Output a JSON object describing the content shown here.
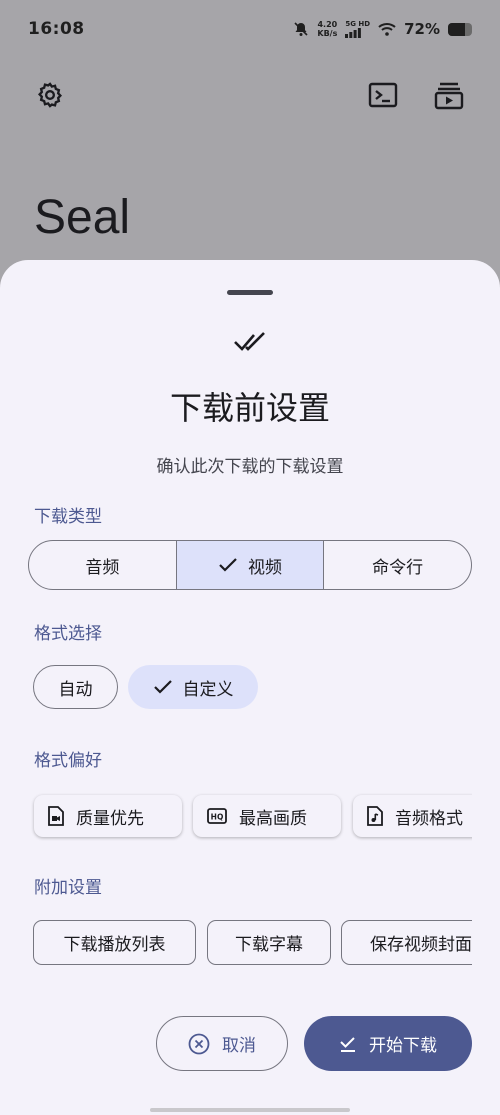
{
  "status_bar": {
    "time": "16:08",
    "speed_value": "4.20",
    "speed_unit": "KB/s",
    "network": "5G HD",
    "battery_text": "72%",
    "battery_level": 0.72
  },
  "app": {
    "title": "Seal"
  },
  "sheet": {
    "title": "下载前设置",
    "subtitle": "确认此次下载的下载设置",
    "download_type": {
      "label": "下载类型",
      "options": [
        "音频",
        "视频",
        "命令行"
      ],
      "selected": "视频"
    },
    "format_selection": {
      "label": "格式选择",
      "options": [
        "自动",
        "自定义"
      ],
      "selected": "自定义"
    },
    "format_preference": {
      "label": "格式偏好",
      "options": [
        "质量优先",
        "最高画质",
        "音频格式"
      ]
    },
    "additional_settings": {
      "label": "附加设置",
      "options": [
        "下载播放列表",
        "下载字幕",
        "保存视频封面"
      ]
    },
    "cancel_label": "取消",
    "start_label": "开始下载"
  },
  "colors": {
    "primary": "#4d5991",
    "selected_container": "#dde1fa",
    "sheet_background": "#f4f2fa",
    "scrim": "#a6a5a9"
  }
}
